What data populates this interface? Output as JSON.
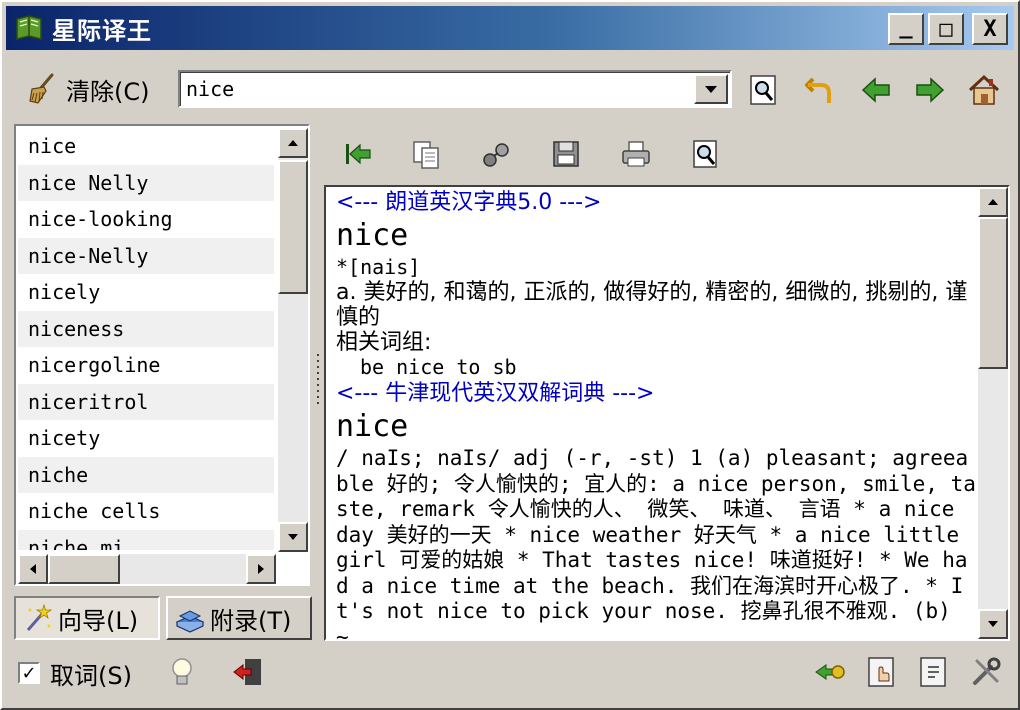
{
  "window": {
    "title": "星际译王"
  },
  "titlebar_buttons": {
    "minimize": "_",
    "maximize": "□",
    "close": "X"
  },
  "toolbar": {
    "clear_label": "清除(C)",
    "search_value": "nice"
  },
  "word_list": [
    "nice",
    "nice Nelly",
    "nice-looking",
    "nice-Nelly",
    "nicely",
    "niceness",
    "nicergoline",
    "niceritrol",
    "nicety",
    "niche",
    "niche cells",
    "niche mi"
  ],
  "tabs": {
    "wizard": "向导(L)",
    "appendix": "附录(T)"
  },
  "definitions": [
    {
      "dict": "<--- 朗道英汉字典5.0 --->",
      "headword": "nice",
      "phonetic": "*[nais]",
      "meaning": "a. 美好的, 和蔼的, 正派的, 做得好的, 精密的, 细微的, 挑剔的, 谨慎的",
      "phrases_label": "相关词组:",
      "phrase": "be nice to sb"
    },
    {
      "dict": "<--- 牛津现代英汉双解词典 --->",
      "headword": "nice",
      "body": "/ naIs; naIs/ adj (-r, -st)  1 (a) pleasant; agreeable 好的; 令人愉快的; 宜人的: a nice person, smile, taste, remark 令人愉快的人、 微笑、 味道、 言语 * a nice day 美好的一天 * nice weather 好天气 * a nice little girl 可爱的姑娘 * That tastes nice! 味道挺好! * We had a nice time at the beach. 我们在海滨时开心极了. * It's not nice to pick your nose. 挖鼻孔很不雅观. (b) ~"
    }
  ],
  "status": {
    "scan_label": "取词(S)",
    "scan_checked": "✓"
  },
  "colors": {
    "dict_header": "#0000c0",
    "title_start": "#0a246a",
    "title_end": "#a6caf0"
  }
}
